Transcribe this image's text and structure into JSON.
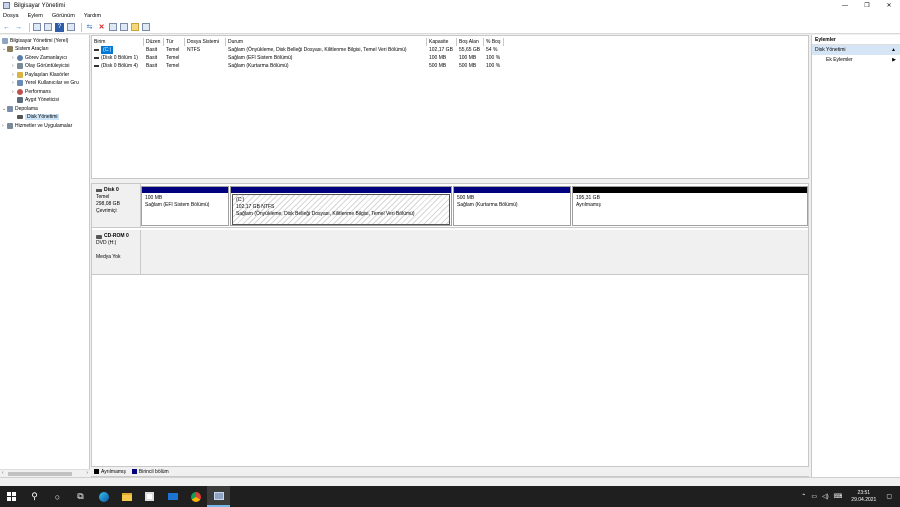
{
  "window": {
    "title": "Bilgisayar Yönetimi",
    "controls": {
      "minimize": "—",
      "maximize": "❐",
      "close": "✕"
    }
  },
  "menu": [
    "Dosya",
    "Eylem",
    "Görünüm",
    "Yardım"
  ],
  "toolbar_icons": [
    "back-arrow-icon",
    "forward-arrow-icon",
    "up-folder-icon",
    "console-tree-icon",
    "help-icon",
    "properties-icon",
    "connect-icon",
    "delete-icon",
    "rescan-icon",
    "export-icon",
    "folder-icon",
    "settings-icon"
  ],
  "tree": {
    "root": "Bilgisayar Yönetimi (Yerel)",
    "items": [
      {
        "label": "Sistem Araçları",
        "expander": "⌄",
        "icon_color": "#8a7f5a"
      },
      {
        "label": "Görev Zamanlayıcı",
        "expander": "›",
        "icon_color": "#5a7ea8"
      },
      {
        "label": "Olay Görüntüleyicisi",
        "expander": "›",
        "icon_color": "#7a8a9a"
      },
      {
        "label": "Paylaşılan Klasörler",
        "expander": "›",
        "icon_color": "#d9b441"
      },
      {
        "label": "Yerel Kullanıcılar ve Gru",
        "expander": "›",
        "icon_color": "#6a8bb5"
      },
      {
        "label": "Performans",
        "expander": "›",
        "icon_color": "#c0504d"
      },
      {
        "label": "Aygıt Yöneticisi",
        "expander": "",
        "icon_color": "#5a6b80"
      },
      {
        "label": "Depolama",
        "expander": "⌄",
        "icon_color": "#7a8ea8"
      },
      {
        "label": "Disk Yönetimi",
        "expander": "",
        "icon_color": "#555555"
      },
      {
        "label": "Hizmetler ve Uygulamalar",
        "expander": "›",
        "icon_color": "#7a8a9a"
      }
    ]
  },
  "volumes": {
    "headers": [
      "Birim",
      "Düzen",
      "Tür",
      "Dosya Sistemi",
      "Durum",
      "Kapasite",
      "Boş Alan",
      "% Boş"
    ],
    "rows": [
      [
        "(C:)",
        "Basit",
        "Temel",
        "NTFS",
        "Sağlam (Önyükleme, Disk Belleği Dosyası, Kilitlenme Bilgisi, Temel Veri Bölümü)",
        "102,17 GB",
        "55,65 GB",
        "54 %"
      ],
      [
        "(Disk 0 Bölüm 1)",
        "Basit",
        "Temel",
        "",
        "Sağlam (EFI Sistem Bölümü)",
        "100 MB",
        "100 MB",
        "100 %"
      ],
      [
        "(Disk 0 Bölüm 4)",
        "Basit",
        "Temel",
        "",
        "Sağlam (Kurtarma Bölümü)",
        "500 MB",
        "500 MB",
        "100 %"
      ]
    ]
  },
  "disks": [
    {
      "name": "Disk 0",
      "type": "Temel",
      "size": "298,08 GB",
      "status": "Çevrimiçi",
      "partitions": [
        {
          "size": "100 MB",
          "status": "Sağlam (EFI Sistem Bölümü)",
          "bar": "#00007f"
        },
        {
          "label": "(C:)",
          "size": "102,17 GB NTFS",
          "status": "Sağlam (Önyükleme, Disk Belleği Dosyası, Kilitlenme Bilgisi, Temel Veri Bölümü)",
          "bar": "#00007f"
        },
        {
          "size": "500 MB",
          "status": "Sağlam (Kurtarma Bölümü)",
          "bar": "#00007f"
        },
        {
          "size": "195,31 GB",
          "status": "Ayrılmamış",
          "bar": "#000000"
        }
      ]
    },
    {
      "name": "CD-ROM 0",
      "type": "DVD (H:)",
      "media": "Medya Yok"
    }
  ],
  "legend": [
    {
      "label": "Ayrılmamış",
      "color": "#000000"
    },
    {
      "label": "Birincil bölüm",
      "color": "#00007f"
    }
  ],
  "actions": {
    "header": "Eylemler",
    "section": "Disk Yönetimi",
    "more": "Ek Eylemler"
  },
  "taskbar": {
    "icons": [
      "start-icon",
      "search-icon",
      "cortana-icon",
      "task-view-icon",
      "edge-icon",
      "file-explorer-icon",
      "store-icon",
      "mail-icon",
      "chrome-icon",
      "computer-management-icon"
    ],
    "time": "23:51",
    "date": "29.04.2021"
  }
}
